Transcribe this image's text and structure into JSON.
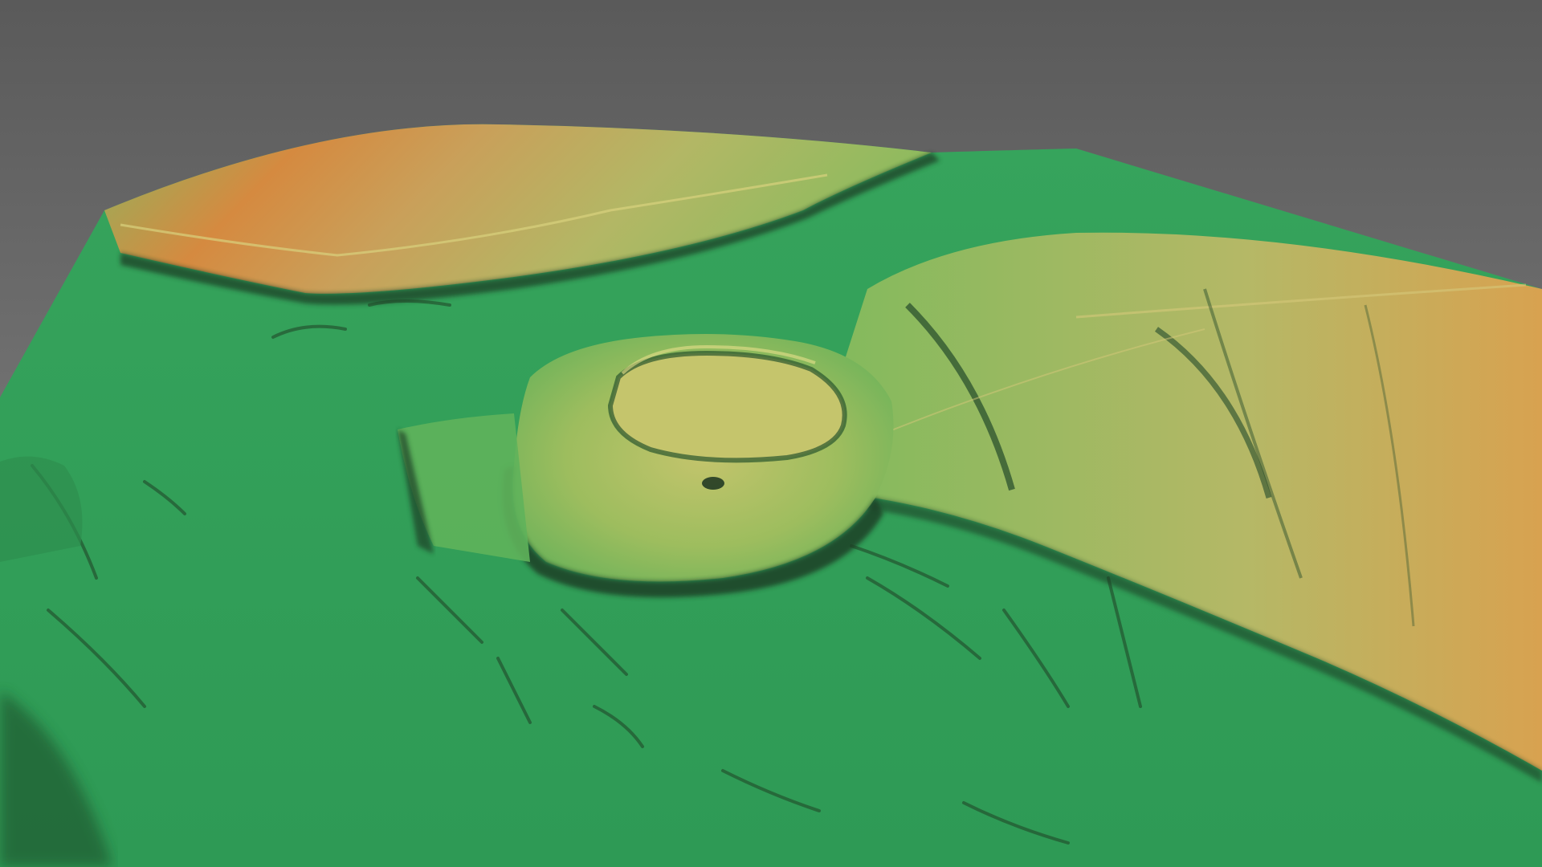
{
  "colors": {
    "background_top": "#5a5a5a",
    "background_bottom": "#8a8a8a",
    "terrain_low": "#3aa35f",
    "terrain_mid": "#7fb85a",
    "terrain_high_yellow": "#c9c06a",
    "terrain_peak_orange": "#e08a3a",
    "shadow": "#1f3f25"
  }
}
